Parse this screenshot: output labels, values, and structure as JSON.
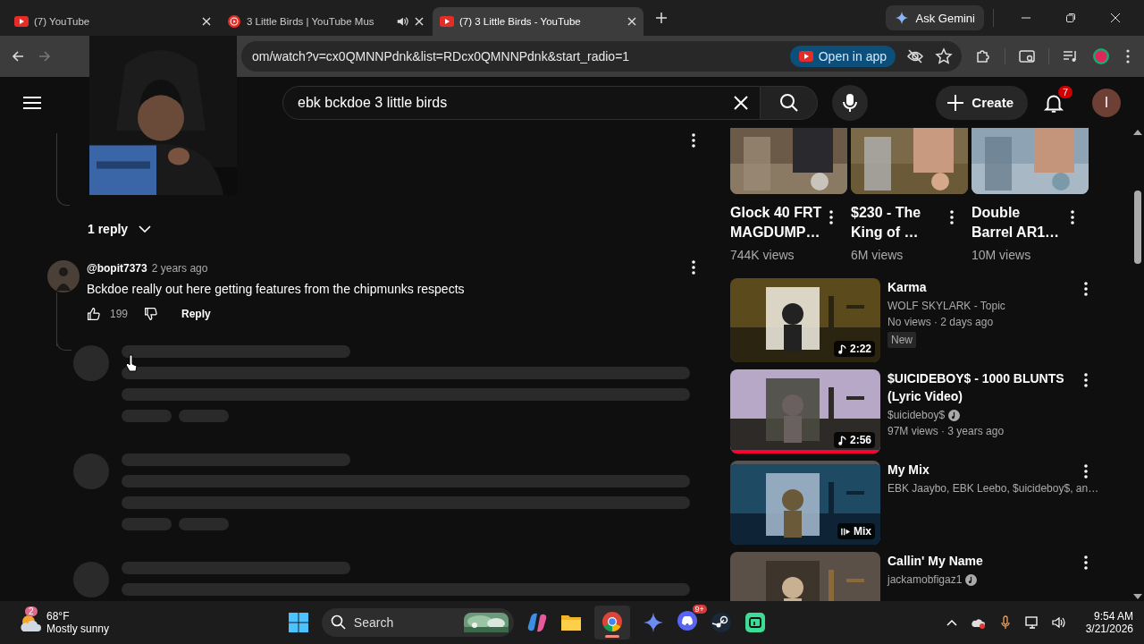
{
  "browser": {
    "tabs": [
      {
        "title": "(7) YouTube",
        "kind": "video",
        "audio": false,
        "selected": false
      },
      {
        "title": "3 Little Birds | YouTube Mus",
        "kind": "music",
        "audio": true,
        "selected": false
      },
      {
        "title": "(7) 3 Little Birds - YouTube",
        "kind": "video",
        "audio": false,
        "selected": true
      }
    ],
    "ask_gemini": "Ask Gemini",
    "url": "om/watch?v=cx0QMNNPdnk&list=RDcx0QMNNPdnk&start_radio=1",
    "open_in_app": "Open in app"
  },
  "header": {
    "search": {
      "value": "ebk bckdoe 3 little birds"
    },
    "create": "Create",
    "notifications": "7",
    "avatar": "I"
  },
  "thread": {
    "replies": "1 reply"
  },
  "comment": {
    "author": "@bopit7373",
    "time": "2 years ago",
    "text": "Bckdoe really out here getting features from the chipmunks respects",
    "likes": "199",
    "reply": "Reply"
  },
  "shorts": [
    {
      "title": "Glock 40 FRT MAGDUMP…",
      "views": "744K views"
    },
    {
      "title": "$230 - The King of …",
      "views": "6M views"
    },
    {
      "title": "Double Barrel AR1…",
      "views": "10M views"
    }
  ],
  "videos": [
    {
      "kind": "video",
      "title": "Karma",
      "channel": "WOLF SKYLARK - Topic",
      "verified": false,
      "meta": "No views · 2 days ago",
      "badge": "New",
      "duration": "2:22"
    },
    {
      "kind": "video",
      "title": "$UICIDEBOY$ - 1000 BLUNTS (Lyric Video)",
      "channel": "$uicideboy$",
      "verified": true,
      "meta": "97M views · 3 years ago",
      "duration": "2:56",
      "level": 1
    },
    {
      "kind": "mix",
      "title": "My Mix",
      "channel": "EBK Jaaybo, EBK Leebo, $uicideboy$, an…",
      "verified": false,
      "duration": "Mix"
    },
    {
      "kind": "video",
      "title": "Callin' My Name",
      "channel": "jackamobfigaz1",
      "verified": true
    }
  ],
  "taskbar": {
    "weather_badge": "2",
    "temperature": "68°F",
    "condition": "Mostly sunny",
    "search": "Search",
    "discord_badge": "9+",
    "time": "9:54 AM",
    "date": "3/21/2026"
  }
}
